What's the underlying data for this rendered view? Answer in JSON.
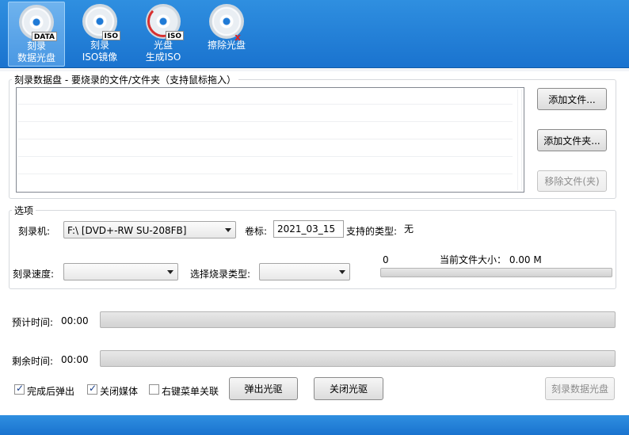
{
  "toolbar": {
    "items": [
      {
        "line1": "刻录",
        "line2": "数据光盘",
        "badge": "DATA"
      },
      {
        "line1": "刻录",
        "line2": "ISO镜像",
        "badge": "ISO"
      },
      {
        "line1": "光盘",
        "line2": "生成ISO",
        "badge": "ISO"
      },
      {
        "line1": "擦除光盘",
        "line2": "",
        "badge": "x"
      }
    ],
    "icons": [
      "data-disc-icon",
      "burn-iso-icon",
      "disc-to-iso-icon",
      "erase-disc-icon"
    ]
  },
  "files_group": {
    "legend": "刻录数据盘 - 要烧录的文件/文件夹（支持鼠标拖入）",
    "add_file": "添加文件...",
    "add_folder": "添加文件夹...",
    "remove_file": "移除文件(夹)"
  },
  "options_group": {
    "legend": "选项",
    "burner_label": "刻录机:",
    "burner_value": "F:\\ [DVD+-RW SU-208FB]",
    "volume_label": "卷标:",
    "volume_value": "2021_03_15",
    "supported_types_label": "支持的类型:",
    "supported_types_value": "无",
    "speed_label": "刻录速度:",
    "speed_value": "",
    "burn_type_label": "选择烧录类型:",
    "burn_type_value": "",
    "count_value": "0",
    "current_file_size": "当前文件大小： 0.00 M",
    "current_progress": 0
  },
  "progress": {
    "estimated_label": "预计时间:",
    "estimated_value": "00:00",
    "estimated_progress": 0,
    "remaining_label": "剩余时间:",
    "remaining_value": "00:00",
    "remaining_progress": 0
  },
  "bottom": {
    "eject_after": {
      "label": "完成后弹出",
      "checked": true
    },
    "close_media": {
      "label": "关闭媒体",
      "checked": true
    },
    "context_menu": {
      "label": "右键菜单关联",
      "checked": false
    },
    "eject_disc": "弹出光驱",
    "close_drive": "关闭光驱",
    "burn_data_disc": "刻录数据光盘"
  },
  "colors": {
    "toolbar_blue": "#1f7fd8",
    "status_blue": "#1a73cf"
  }
}
